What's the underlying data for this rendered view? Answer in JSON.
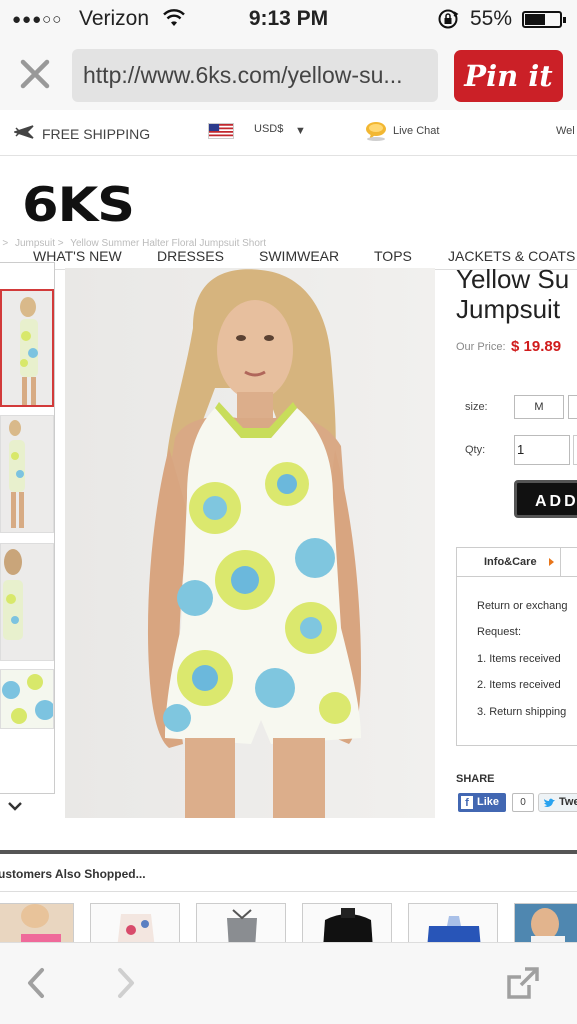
{
  "status_bar": {
    "signal": "●●●○○",
    "carrier": "Verizon",
    "time": "9:13 PM",
    "battery_percent": "55%",
    "battery_level": 0.55
  },
  "browser": {
    "url": "http://www.6ks.com/yellow-su...",
    "pin_button": "Pin it"
  },
  "top_strip": {
    "shipping": "FREE SHIPPING",
    "currency": "USD$",
    "currency_caret": "▼",
    "chat": "Live Chat",
    "welcome": "Wel"
  },
  "logo": "6KS",
  "breadcrumb": [
    "e >",
    "Jumpsuit >",
    "Yellow Summer Halter Floral Jumpsuit Short"
  ],
  "nav": {
    "items": [
      "WHAT'S NEW",
      "DRESSES",
      "SWIMWEAR",
      "TOPS",
      "JACKETS & COATS"
    ]
  },
  "product": {
    "title_line1": "Yellow Su",
    "title_line2": "Jumpsuit",
    "price_label": "Our Price:",
    "price": "$ 19.89",
    "size_label": "size:",
    "size_value": "M",
    "qty_label": "Qty:",
    "qty_value": "1",
    "add_button": "ADD",
    "tab_info": "Info&Care",
    "info_lines": [
      "Return or exchang",
      "Request:",
      "1. Items received",
      "2. Items received",
      "3. Return shipping"
    ],
    "share_label": "SHARE",
    "like_label": "Like",
    "like_count": "0",
    "tweet_label": "Twe"
  },
  "also": {
    "heading": "ustomers Also Shopped..."
  },
  "colors": {
    "pin_red": "#cb2027",
    "price_red": "#d01c1c",
    "facebook_blue": "#4267b2"
  }
}
